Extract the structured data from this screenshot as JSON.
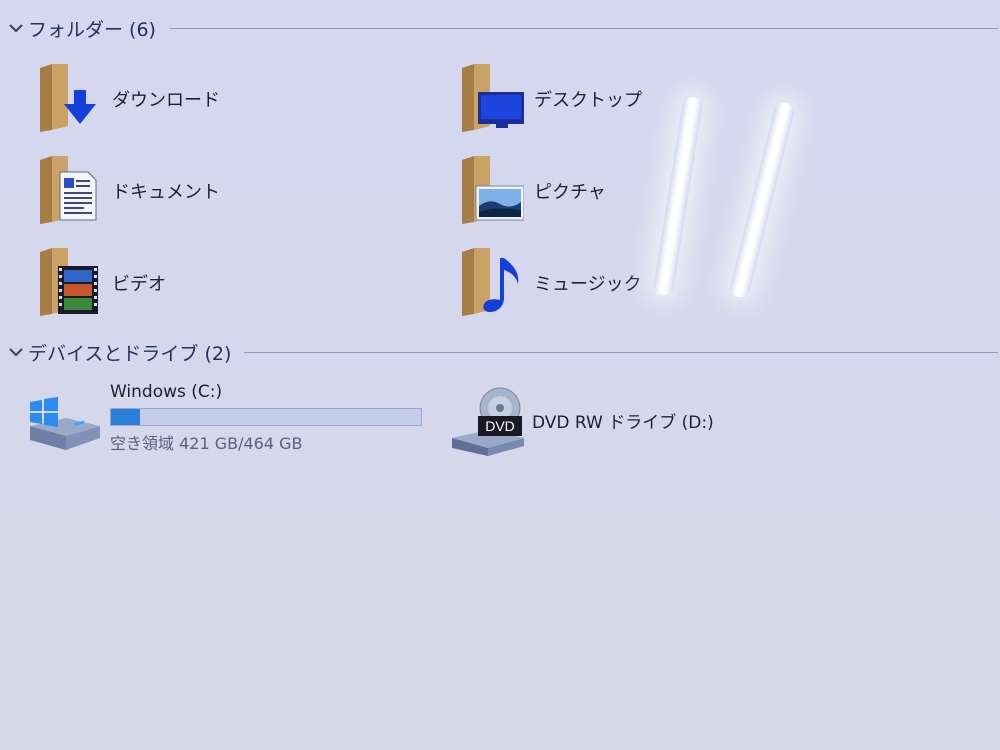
{
  "sections": {
    "folders": {
      "title": "フォルダー (6)",
      "items": [
        {
          "label": "ダウンロード",
          "icon": "download-arrow-icon"
        },
        {
          "label": "デスクトップ",
          "icon": "desktop-monitor-icon"
        },
        {
          "label": "ドキュメント",
          "icon": "document-page-icon"
        },
        {
          "label": "ピクチャ",
          "icon": "picture-landscape-icon"
        },
        {
          "label": "ビデオ",
          "icon": "video-filmstrip-icon"
        },
        {
          "label": "ミュージック",
          "icon": "music-note-icon"
        }
      ]
    },
    "drives": {
      "title": "デバイスとドライブ (2)",
      "items": [
        {
          "name": "Windows (C:)",
          "space": "空き領域 421 GB/464 GB",
          "used_fraction": 0.093,
          "icon": "windows-drive-icon"
        },
        {
          "name": "DVD RW ドライブ (D:)",
          "icon": "dvd-drive-icon",
          "badge": "DVD"
        }
      ]
    }
  },
  "colors": {
    "accent": "#2c7fd8",
    "folder_tan": "#c9a266",
    "folder_dark": "#a67e45",
    "icon_blue": "#1340d8"
  }
}
